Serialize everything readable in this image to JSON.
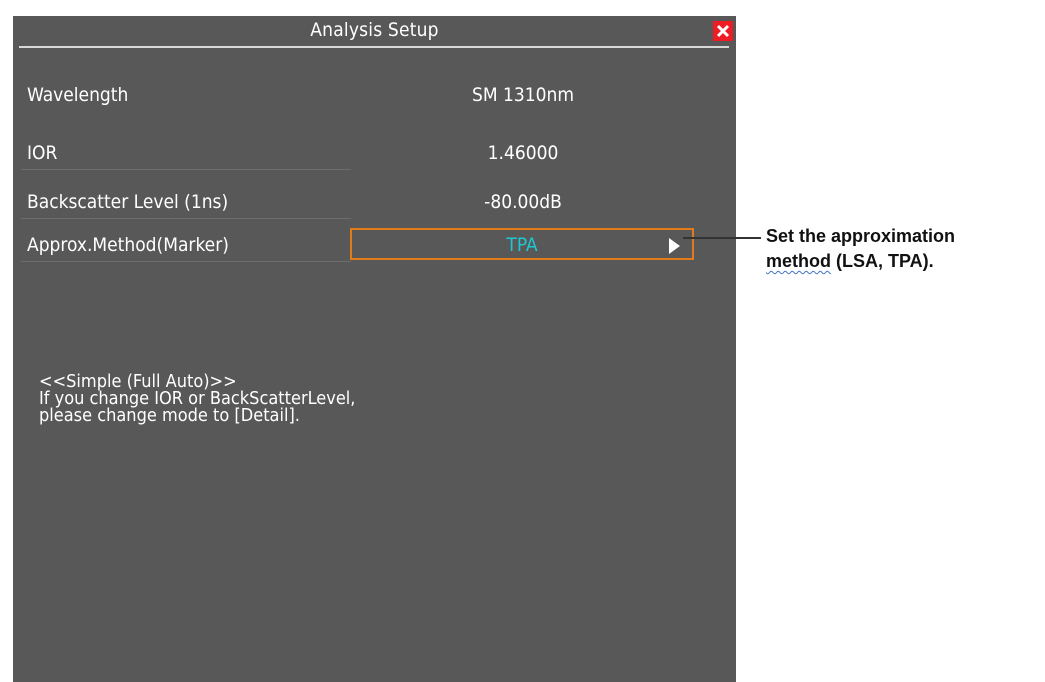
{
  "dialog": {
    "title": "Analysis Setup",
    "close_icon": "close-icon",
    "rows": [
      {
        "label": "Wavelength",
        "value": "SM 1310nm"
      },
      {
        "label": "IOR",
        "value": "1.46000"
      },
      {
        "label": "Backscatter Level (1ns)",
        "value": "-80.00dB"
      },
      {
        "label": "Approx.Method(Marker)",
        "value": "TPA"
      }
    ],
    "message": [
      "<<Simple (Full Auto)>>",
      "If you change IOR or BackScatterLevel,",
      "please change mode to [Detail]."
    ]
  },
  "callout": {
    "line1": "Set the approximation",
    "line2_word": "method",
    "line2_rest": " (LSA, TPA)."
  },
  "colors": {
    "panel": "#585858",
    "selection_border": "#e07a1a",
    "selected_value": "#1ec8d2",
    "close": "#ee1c25"
  }
}
